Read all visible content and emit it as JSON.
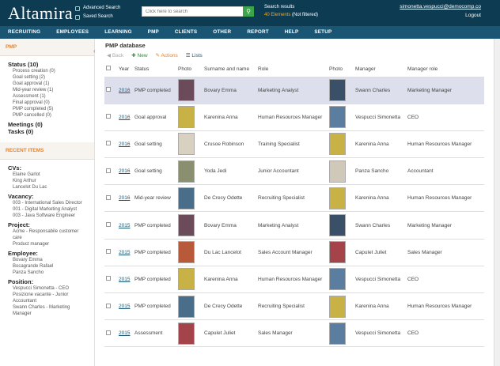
{
  "header": {
    "logo": "Altamira",
    "advanced_search": "Advanced Search",
    "saved_search": "Saved Search",
    "search_placeholder": "Click here to search",
    "search_results_label": "Search results",
    "elements_found": "40 Elements",
    "not_filtered": "(Not filtered)",
    "user_email": "simonetta.vespucci@democomp.co",
    "logout": "Logout"
  },
  "nav": [
    "RECRUITING",
    "EMPLOYEES",
    "LEARNING",
    "PMP",
    "CLIENTS",
    "OTHER",
    "REPORT",
    "HELP",
    "SETUP"
  ],
  "sidebar": {
    "pmp_header": "PMP",
    "status_title": "Status (10)",
    "statuses": [
      "Process creation (0)",
      "Goal setting (2)",
      "Goal approval (1)",
      "Mid-year review (1)",
      "Assessment (1)",
      "Final approval (0)",
      "PMP completed (5)",
      "PMP cancelled (0)"
    ],
    "meetings": "Meetings (0)",
    "tasks": "Tasks (0)",
    "recent_header": "RECENT ITEMS",
    "cvs_title": "CVs:",
    "cvs": [
      "Elaine Garlot",
      "King Arthur",
      "Lancelot Du Lac"
    ],
    "vacancy_title": "Vacancy:",
    "vacancies": [
      "003 - International Sales Director",
      "001 - Digital Marketing Analyst",
      "003 - Java Software Engineer"
    ],
    "project_title": "Project:",
    "projects": [
      "Acme - Responsabile customer care",
      "Product manager"
    ],
    "employee_title": "Employee:",
    "employees": [
      "Bovary Emma",
      "Bocagrande Rafael",
      "Panza Sancho"
    ],
    "position_title": "Position:",
    "positions": [
      "Vespucci Simonetta - CEO",
      "Posizione vacante - Junior Accountant",
      "Swann Charles - Marketing Manager"
    ]
  },
  "main": {
    "title": "PMP database",
    "back": "Back",
    "new": "New",
    "actions": "Actions",
    "lists": "Lists",
    "columns": [
      "Year",
      "Status",
      "Photo",
      "Surname and name",
      "Role",
      "Photo",
      "Manager",
      "Manager role"
    ],
    "rows": [
      {
        "year": "2016",
        "status": "PMP completed",
        "name": "Bovary Emma",
        "role": "Marketing Analyst",
        "manager": "Swann Charles",
        "manager_role": "Marketing Manager"
      },
      {
        "year": "2016",
        "status": "Goal approval",
        "name": "Karenina Anna",
        "role": "Human Resources Manager",
        "manager": "Vespucci Simonetta",
        "manager_role": "CEO"
      },
      {
        "year": "2016",
        "status": "Goal setting",
        "name": "Crusoe Robinson",
        "role": "Training Specialist",
        "manager": "Karenina Anna",
        "manager_role": "Human Resources Manager"
      },
      {
        "year": "2016",
        "status": "Goal setting",
        "name": "Yoda Jedi",
        "role": "Junior Accountant",
        "manager": "Panza Sancho",
        "manager_role": "Accountant"
      },
      {
        "year": "2016",
        "status": "Mid-year review",
        "name": "De Crecy Odette",
        "role": "Recruiting Specialist",
        "manager": "Karenina Anna",
        "manager_role": "Human Resources Manager"
      },
      {
        "year": "2015",
        "status": "PMP completed",
        "name": "Bovary Emma",
        "role": "Marketing Analyst",
        "manager": "Swann Charles",
        "manager_role": "Marketing Manager"
      },
      {
        "year": "2015",
        "status": "PMP completed",
        "name": "Du Lac Lancelot",
        "role": "Sales Account Manager",
        "manager": "Capulet Juliet",
        "manager_role": "Sales Manager"
      },
      {
        "year": "2015",
        "status": "PMP completed",
        "name": "Karenina Anna",
        "role": "Human Resources Manager",
        "manager": "Vespucci Simonetta",
        "manager_role": "CEO"
      },
      {
        "year": "2015",
        "status": "PMP completed",
        "name": "De Crecy Odette",
        "role": "Recruiting Specialist",
        "manager": "Karenina Anna",
        "manager_role": "Human Resources Manager"
      },
      {
        "year": "2015",
        "status": "Assessment",
        "name": "Capulet Juliet",
        "role": "Sales Manager",
        "manager": "Vespucci Simonetta",
        "manager_role": "CEO"
      }
    ]
  }
}
